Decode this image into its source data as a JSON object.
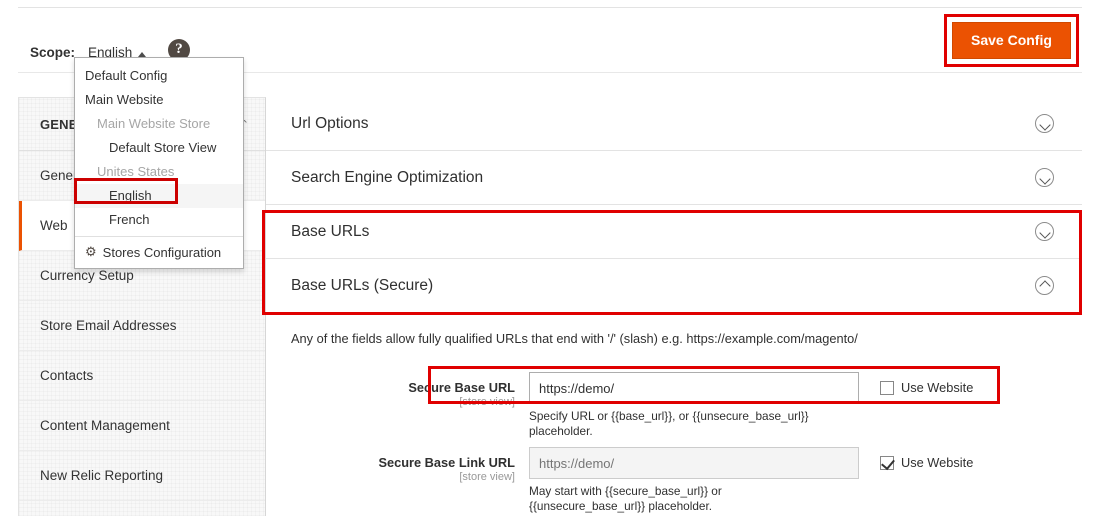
{
  "colors": {
    "accent": "#eb5202",
    "annotation": "#e00000",
    "selection": "#cc0000",
    "text": "#303030",
    "muted": "#999999"
  },
  "scope_bar": {
    "label": "Scope:",
    "value": "English",
    "caret_icon": "caret-up-icon",
    "help_icon": "help-circle-icon",
    "help_glyph": "?"
  },
  "toolbar": {
    "save_label": "Save Config"
  },
  "scope_menu": {
    "items": [
      {
        "label": "Default Config",
        "level": 1,
        "muted": false,
        "selected": false
      },
      {
        "label": "Main Website",
        "level": 1,
        "muted": false,
        "selected": false
      },
      {
        "label": "Main Website Store",
        "level": 2,
        "muted": true,
        "selected": false
      },
      {
        "label": "Default Store View",
        "level": 3,
        "muted": false,
        "selected": false
      },
      {
        "label": "Unites States",
        "level": 2,
        "muted": true,
        "selected": false
      },
      {
        "label": "English",
        "level": 3,
        "muted": false,
        "selected": true
      },
      {
        "label": "French",
        "level": 3,
        "muted": false,
        "selected": false
      }
    ],
    "footer": {
      "label": "Stores Configuration",
      "icon": "gear-icon",
      "glyph": "⚙"
    }
  },
  "sidebar": {
    "header": {
      "title": "GENERAL",
      "collapse_icon": "chevron-up-icon",
      "glyph": "⌃"
    },
    "items": [
      {
        "label": "General",
        "active": false
      },
      {
        "label": "Web",
        "active": true
      },
      {
        "label": "Currency Setup",
        "active": false
      },
      {
        "label": "Store Email Addresses",
        "active": false
      },
      {
        "label": "Contacts",
        "active": false
      },
      {
        "label": "Content Management",
        "active": false
      },
      {
        "label": "New Relic Reporting",
        "active": false
      }
    ]
  },
  "content": {
    "sections": [
      {
        "title": "Url Options",
        "expanded": false,
        "icon": "chevron-down-circle-icon",
        "highlighted": false
      },
      {
        "title": "Search Engine Optimization",
        "expanded": false,
        "icon": "chevron-down-circle-icon",
        "highlighted": false
      },
      {
        "title": "Base URLs",
        "expanded": false,
        "icon": "chevron-down-circle-icon",
        "highlighted": true
      },
      {
        "title": "Base URLs (Secure)",
        "expanded": true,
        "icon": "chevron-up-circle-icon",
        "highlighted": true
      }
    ],
    "panel": {
      "note": "Any of the fields allow fully qualified URLs that end with '/' (slash) e.g. https://example.com/magento/",
      "fields": [
        {
          "label": "Secure Base URL",
          "scope": "[store view]",
          "value": "https://demo/",
          "placeholder": "",
          "disabled": false,
          "hint": "Specify URL or {{base_url}}, or {{unsecure_base_url}} placeholder.",
          "checkbox": {
            "label": "Use Website",
            "checked": false
          },
          "highlighted": true
        },
        {
          "label": "Secure Base Link URL",
          "scope": "[store view]",
          "value": "",
          "placeholder": "https://demo/",
          "disabled": true,
          "hint": "May start with {{secure_base_url}} or {{unsecure_base_url}} placeholder.",
          "checkbox": {
            "label": "Use Website",
            "checked": true
          },
          "highlighted": false
        }
      ]
    }
  }
}
